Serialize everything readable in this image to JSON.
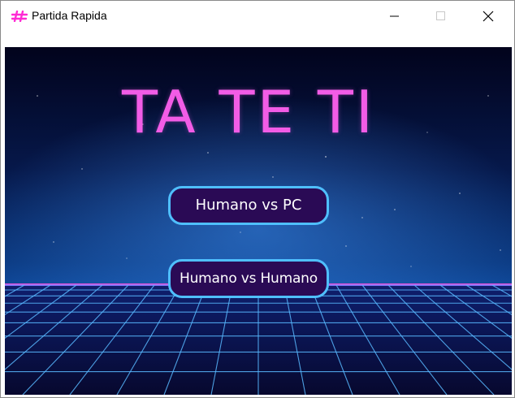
{
  "window": {
    "title": "Partida Rapida",
    "icon": "hash-icon",
    "controls": [
      "minimize-icon",
      "maximize-icon",
      "close-icon"
    ]
  },
  "game": {
    "title": "TA TE TI",
    "buttons": {
      "human_vs_pc": "Humano vs PC",
      "human_vs_human": "Humano vs Humano"
    }
  },
  "colors": {
    "title_pink": "#f25ce6",
    "button_border": "#4fbfff",
    "button_fill": "#2a0a55",
    "grid_line": "#58b8ff",
    "sky_top": "#03041f",
    "horizon_pink": "#ff48c8"
  }
}
